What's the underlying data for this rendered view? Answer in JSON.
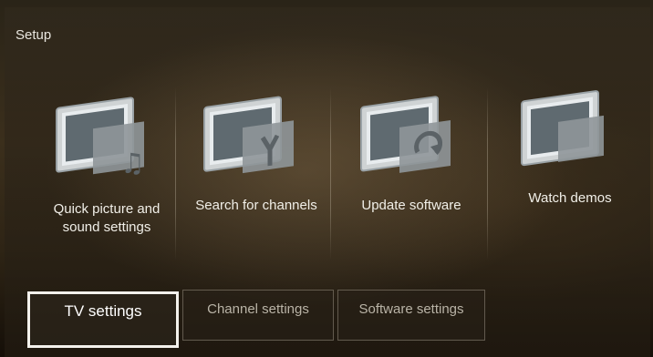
{
  "screen": {
    "title": "Setup"
  },
  "tiles": [
    {
      "label": "Quick picture and\nsound settings",
      "icon": "music-note-icon"
    },
    {
      "label": "Search for channels",
      "icon": "antenna-icon"
    },
    {
      "label": "Update software",
      "icon": "refresh-icon"
    },
    {
      "label": "Watch demos",
      "icon": "demo-screen-icon"
    }
  ],
  "tabs": [
    {
      "label": "TV settings",
      "selected": true
    },
    {
      "label": "Channel settings",
      "selected": false
    },
    {
      "label": "Software settings",
      "selected": false
    }
  ],
  "colors": {
    "text": "#f1efe8",
    "tab_inactive_text": "#b9b3a6",
    "selected_border": "#f3f1ec"
  }
}
